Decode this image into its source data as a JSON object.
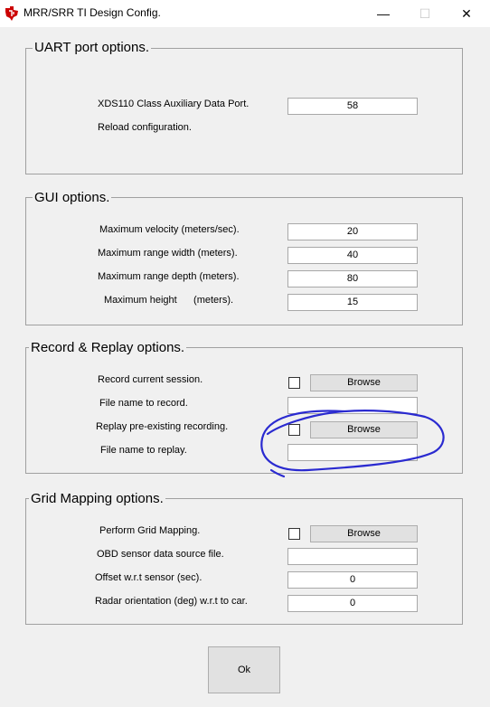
{
  "window": {
    "title": "MRR/SRR TI Design Config.",
    "minimize_glyph": "—",
    "maximize_glyph": "☐",
    "close_glyph": "✕",
    "icon": "ti-logo-icon"
  },
  "uart": {
    "title": "UART port options.",
    "port_label": "XDS110 Class Auxiliary Data Port.",
    "port_value": "58",
    "reload_label": "Reload configuration."
  },
  "gui": {
    "title": "GUI options.",
    "velocity_label": "Maximum velocity (meters/sec).",
    "velocity_value": "20",
    "range_width_label": "Maximum range width (meters).",
    "range_width_value": "40",
    "range_depth_label": "Maximum range depth (meters).",
    "range_depth_value": "80",
    "height_label": "Maximum height      (meters).",
    "height_value": "15"
  },
  "record": {
    "title": "Record & Replay options.",
    "record_label": "Record current session.",
    "record_checked": false,
    "record_browse": "Browse",
    "record_file_label": "File name to record.",
    "record_file_value": "",
    "replay_label": "Replay pre-existing recording.",
    "replay_checked": false,
    "replay_browse": "Browse",
    "replay_file_label": "File name to replay.",
    "replay_file_value": ""
  },
  "grid": {
    "title": "Grid Mapping options.",
    "perform_label": "Perform Grid Mapping.",
    "perform_checked": false,
    "perform_browse": "Browse",
    "obd_label": "OBD sensor data source file.",
    "obd_value": "",
    "offset_label": "Offset w.r.t sensor (sec).",
    "offset_value": "0",
    "orientation_label": "Radar orientation (deg) w.r.t to car.",
    "orientation_value": "0"
  },
  "ok_label": "Ok",
  "colors": {
    "annotation_ink": "#2a2ad0",
    "ti_red": "#cc0000",
    "dialog_bg": "#f0f0f0"
  }
}
